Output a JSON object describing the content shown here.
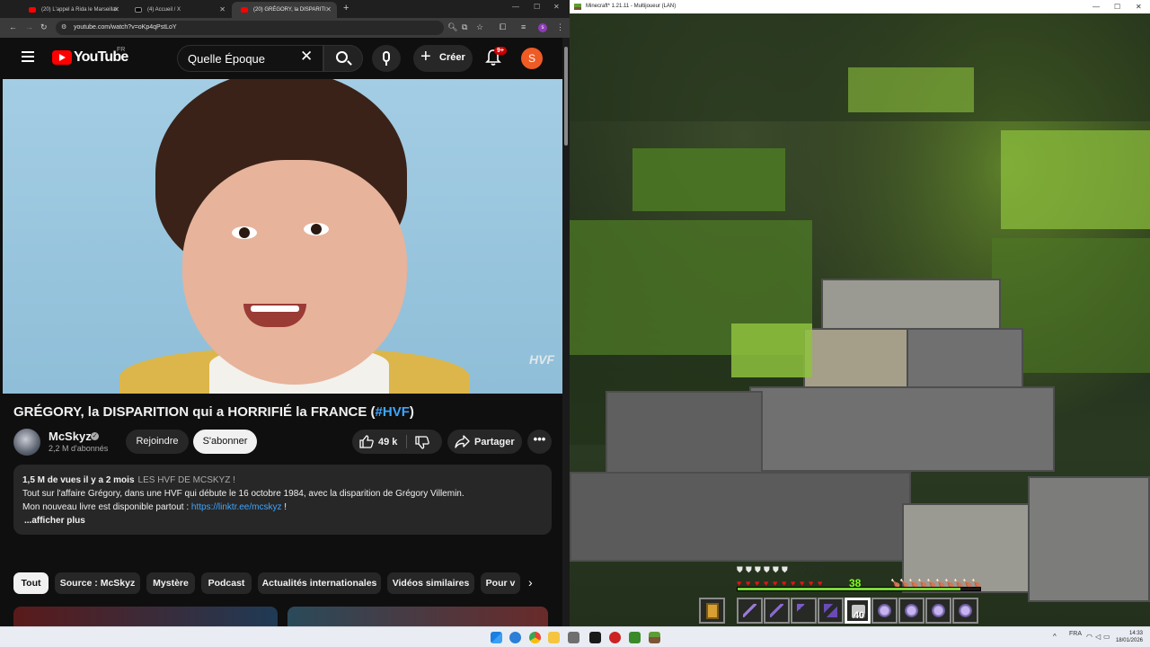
{
  "browser": {
    "tabs": [
      {
        "label": "(20) L'appel à Rida le Marseillai",
        "favicon_color": "#ff0000"
      },
      {
        "label": "(4) Accueil / X",
        "favicon_color": "#000000"
      },
      {
        "label": "(20) GRÉGORY, la DISPARITI",
        "favicon_color": "#ff0000"
      }
    ],
    "new_tab_icon": "plus-icon",
    "url": "youtube.com/watch?v=oKp4qPstLoY"
  },
  "youtube": {
    "logo_text": "YouTube",
    "region": "FR",
    "search_value": "Quelle Époque",
    "create_label": "Créer",
    "notif_count": "9+",
    "avatar_letter": "S",
    "watermark": "HVF",
    "video": {
      "title_main": "GRÉGORY, la DISPARITION qui a HORRIFIÉ la FRANCE (",
      "title_hashtag": "#HVF",
      "title_end": ")"
    },
    "channel": {
      "name": "McSkyz",
      "subscribers": "2,2 M d'abonnés",
      "join_label": "Rejoindre",
      "subscribe_label": "S'abonner"
    },
    "actions": {
      "likes": "49 k",
      "share_label": "Partager",
      "more_label": "•••"
    },
    "description": {
      "stats": "1,5 M de vues  il y a 2 mois",
      "tag": "LES HVF DE MCSKYZ !",
      "line1": "Tout sur l'affaire Grégory, dans une HVF qui débute le 16 octobre 1984, avec la disparition de Grégory Villemin.",
      "line2_prefix": "Mon nouveau livre est disponible partout : ",
      "line2_link": "https://linktr.ee/mcskyz",
      "line2_suffix": " !",
      "more": "...afficher plus"
    },
    "chips": [
      "Tout",
      "Source : McSkyz",
      "Mystère",
      "Podcast",
      "Actualités internationales",
      "Vidéos similaires",
      "Pour v"
    ]
  },
  "minecraft": {
    "window_title": "Minecraft* 1.21.11 - Multijoueur (LAN)",
    "xp_level": "38",
    "xp_progress": 0.92,
    "stack_count": "40",
    "hotbar_selected_slot": 5,
    "armor": 6,
    "health": 10,
    "hunger": 5
  },
  "taskbar": {
    "language": "FRA",
    "time": "14:33",
    "date": "18/01/2026"
  }
}
